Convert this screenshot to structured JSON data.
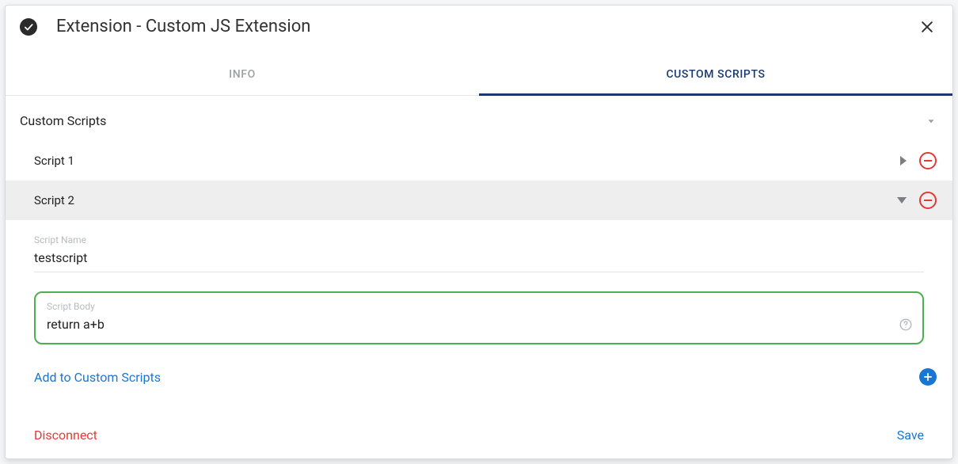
{
  "header": {
    "title": "Extension - Custom JS Extension"
  },
  "tabs": {
    "info": "INFO",
    "custom_scripts": "CUSTOM SCRIPTS"
  },
  "section": {
    "title": "Custom Scripts"
  },
  "scripts": [
    {
      "label": "Script 1",
      "expanded": false
    },
    {
      "label": "Script 2",
      "expanded": true
    }
  ],
  "script2": {
    "name_label": "Script Name",
    "name_value": "testscript",
    "body_label": "Script Body",
    "body_value": "return a+b"
  },
  "actions": {
    "add": "Add to Custom Scripts",
    "disconnect": "Disconnect",
    "save": "Save"
  }
}
